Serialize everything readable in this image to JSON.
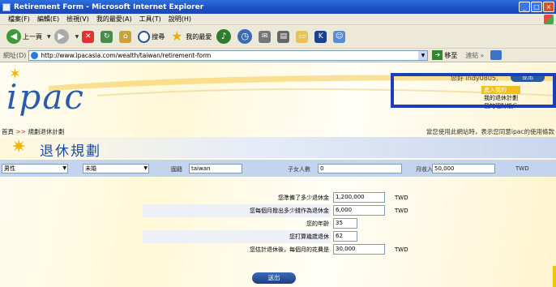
{
  "window": {
    "title": "Retirement Form - Microsoft Internet Explorer"
  },
  "menu": [
    "檔案(F)",
    "編輯(E)",
    "檢視(V)",
    "我的最愛(A)",
    "工具(T)",
    "說明(H)"
  ],
  "toolbar": {
    "back": "上一頁",
    "search": "搜尋",
    "favorites": "我的最愛"
  },
  "address": {
    "label": "網址(D)",
    "url": "http://www.ipacasia.com/wealth/taiwan/retirement-form",
    "go": "移至",
    "links": "連結"
  },
  "header": {
    "logo": "ipac",
    "greeting": "您好 indy0805,",
    "logout": "登出",
    "side_menu": [
      "進入我的",
      "我的退休計劃",
      "我的理財帳戶"
    ]
  },
  "breadcrumb": {
    "home": "首頁",
    "sep": ">>",
    "current": "規劃退休計劃"
  },
  "notice": "當您使用此網站時，表示您同意ipac的使用條款",
  "page_title": "退休規劃",
  "filters": {
    "gender": "男性",
    "marital": "未婚",
    "country_label": "國籍",
    "country": "taiwan",
    "children_label": "子女人數",
    "children": "0",
    "income_label": "月收入",
    "income": "50,000",
    "currency": "TWD"
  },
  "form": [
    {
      "label": "您準備了多少退休金",
      "value": "1,200,000",
      "unit": "TWD"
    },
    {
      "label": "您每個月撥出多少錢作為退休金",
      "value": "6,000",
      "unit": "TWD"
    },
    {
      "label": "您的年齡",
      "value": "35",
      "unit": ""
    },
    {
      "label": "您打算幾歲退休",
      "value": "62",
      "unit": ""
    },
    {
      "label": "您估計退休後，每個月的花費是",
      "value": "30,000",
      "unit": "TWD"
    }
  ],
  "submit": "送出"
}
